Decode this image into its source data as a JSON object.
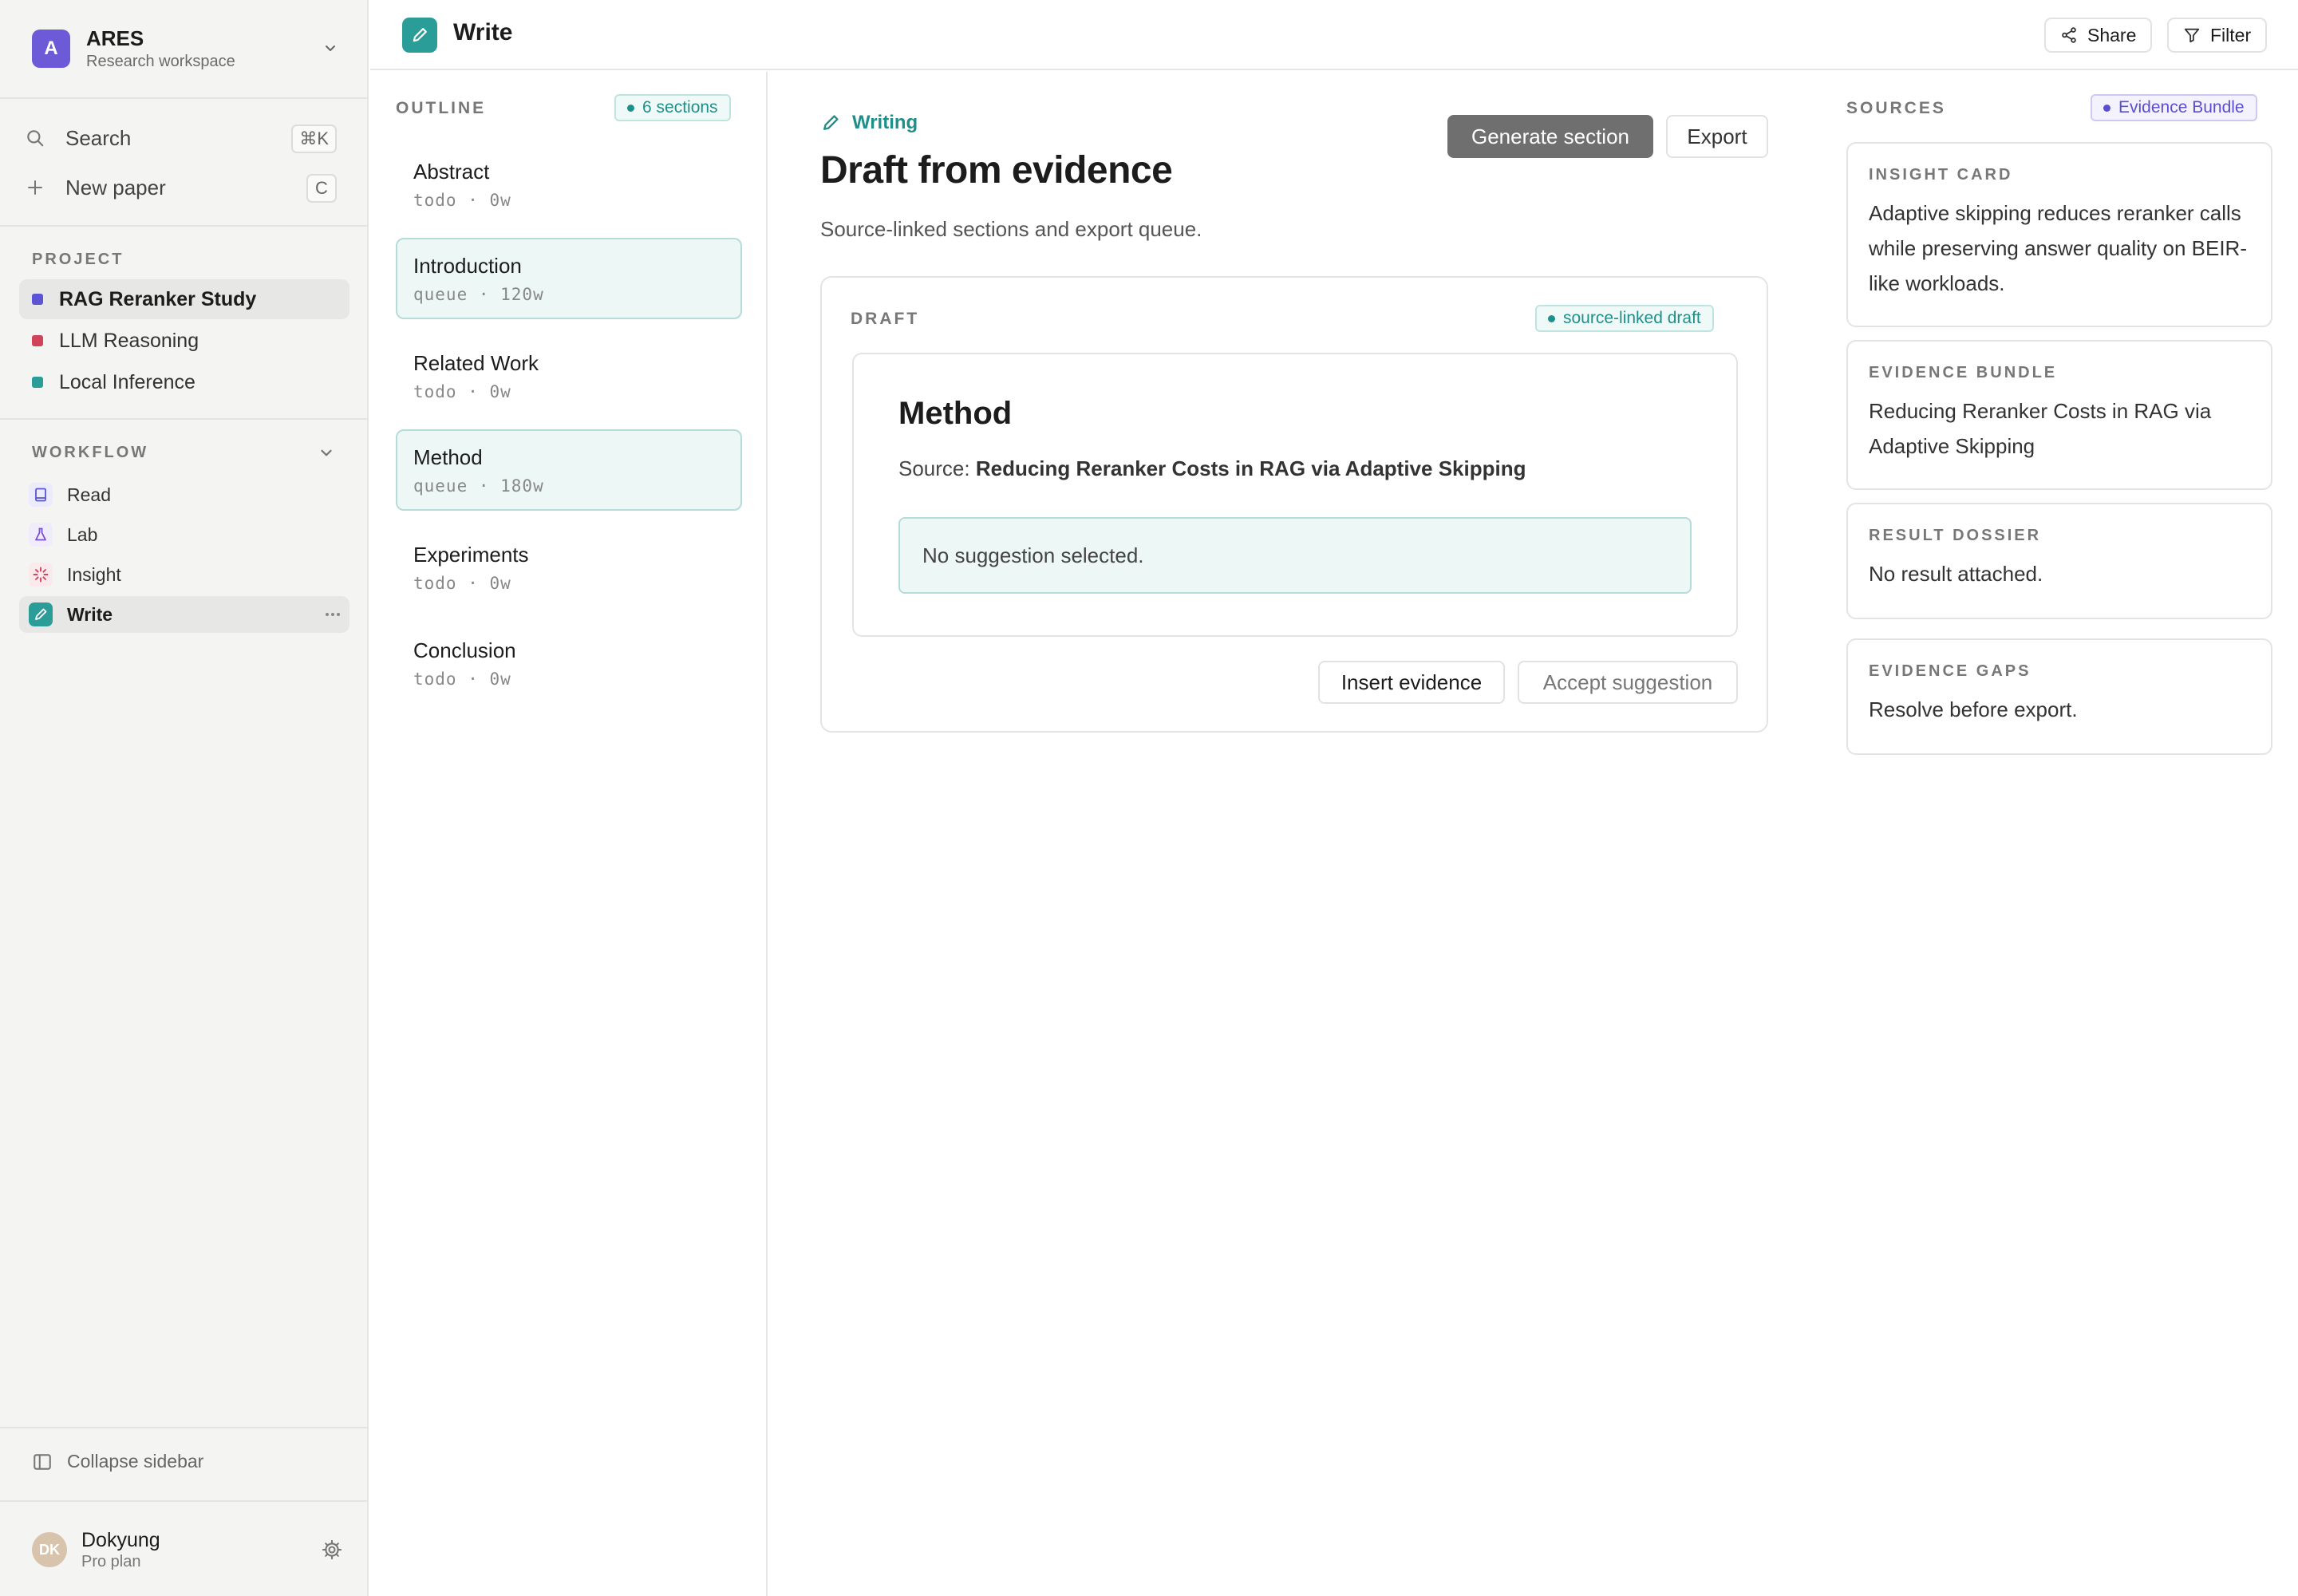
{
  "workspace": {
    "initial": "A",
    "name": "ARES",
    "subtitle": "Research workspace"
  },
  "sidebar": {
    "search_label": "Search",
    "search_shortcut": "⌘K",
    "new_paper_label": "New paper",
    "new_paper_shortcut": "C",
    "project_header": "PROJECT",
    "projects": [
      {
        "label": "RAG Reranker Study",
        "color": "#5b55d6",
        "active": true
      },
      {
        "label": "LLM Reasoning",
        "color": "#d1435b",
        "active": false
      },
      {
        "label": "Local Inference",
        "color": "#2a9d98",
        "active": false
      }
    ],
    "workflow_header": "WORKFLOW",
    "workflow": [
      {
        "label": "Read",
        "icon": "book-icon"
      },
      {
        "label": "Lab",
        "icon": "flask-icon"
      },
      {
        "label": "Insight",
        "icon": "sparkle-icon"
      },
      {
        "label": "Write",
        "icon": "pencil-icon",
        "active": true
      }
    ],
    "collapse_label": "Collapse sidebar",
    "user": {
      "initials": "DK",
      "name": "Dokyung",
      "plan": "Pro plan"
    }
  },
  "topbar": {
    "title": "Write",
    "share_label": "Share",
    "filter_label": "Filter"
  },
  "outline": {
    "header": "OUTLINE",
    "badge": "6 sections",
    "items": [
      {
        "title": "Abstract",
        "meta": "todo · 0w",
        "active": false
      },
      {
        "title": "Introduction",
        "meta": "queue · 120w",
        "active": true
      },
      {
        "title": "Related Work",
        "meta": "todo · 0w",
        "active": false
      },
      {
        "title": "Method",
        "meta": "queue · 180w",
        "active": true
      },
      {
        "title": "Experiments",
        "meta": "todo · 0w",
        "active": false
      },
      {
        "title": "Conclusion",
        "meta": "todo · 0w",
        "active": false
      }
    ]
  },
  "main": {
    "eyebrow": "Writing",
    "title": "Draft from evidence",
    "subtitle": "Source-linked sections and export queue.",
    "generate_label": "Generate section",
    "export_label": "Export",
    "draft": {
      "header": "DRAFT",
      "badge": "source-linked draft",
      "section_title": "Method",
      "source_prefix": "Source:",
      "source_title": "Reducing Reranker Costs in RAG via Adaptive Skipping",
      "suggestion": "No suggestion selected.",
      "insert_label": "Insert evidence",
      "accept_label": "Accept suggestion"
    }
  },
  "sources": {
    "header": "SOURCES",
    "badge": "Evidence Bundle",
    "cards": [
      {
        "label": "INSIGHT CARD",
        "body": "Adaptive skipping reduces reranker calls while preserving answer quality on BEIR-like workloads."
      },
      {
        "label": "EVIDENCE BUNDLE",
        "body": "Reducing Reranker Costs in RAG via Adaptive Skipping"
      },
      {
        "label": "RESULT DOSSIER",
        "body": "No result attached."
      },
      {
        "label": "EVIDENCE GAPS",
        "body": "Resolve before export."
      }
    ]
  },
  "colors": {
    "accent_teal": "#2a9d98",
    "accent_violet": "#5a4fd0",
    "workspace_avatar": "#6c5ad6"
  }
}
